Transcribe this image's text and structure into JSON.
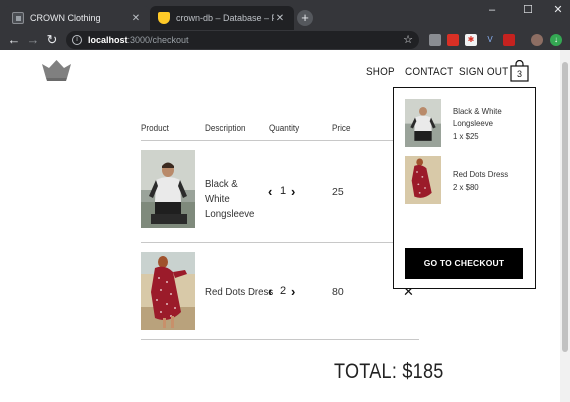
{
  "browser": {
    "tabs": [
      {
        "label": "CROWN Clothing",
        "active": true
      },
      {
        "label": "crown-db – Database – Firebase",
        "active": false
      }
    ],
    "new_tab_label": "+",
    "window_controls": {
      "minimize": "–",
      "maximize": "☐",
      "close": "✕"
    },
    "url_host": "localhost",
    "url_path": ":3000/checkout"
  },
  "nav": {
    "shop": "SHOP",
    "contact": "CONTACT",
    "sign_out": "SIGN OUT",
    "cart_count": "3"
  },
  "checkout": {
    "headers": {
      "product": "Product",
      "description": "Description",
      "quantity": "Quantity",
      "price": "Price"
    },
    "items": [
      {
        "name": "Black & White Longsleeve",
        "quantity": "1",
        "price": "25",
        "remove": "✕"
      },
      {
        "name": "Red Dots Dress",
        "quantity": "2",
        "price": "80",
        "remove": "✕"
      }
    ],
    "total": "TOTAL: $185"
  },
  "cart_dropdown": {
    "items": [
      {
        "name": "Black & White Longsleeve",
        "qty_line": "1 x $25"
      },
      {
        "name": "Red Dots Dress",
        "qty_line": "2 x $80"
      }
    ],
    "button": "GO TO CHECKOUT"
  },
  "icons": [
    "crown-logo-icon",
    "shopping-bag-icon",
    "chevron-left-icon",
    "chevron-right-icon",
    "close-icon",
    "back-arrow-icon",
    "forward-arrow-icon",
    "reload-icon",
    "info-icon",
    "star-icon"
  ],
  "colors": {
    "chrome_dark": "#35363a",
    "omnibox": "#202124",
    "button_black": "#000000",
    "dress_red": "#9b1b2a"
  }
}
